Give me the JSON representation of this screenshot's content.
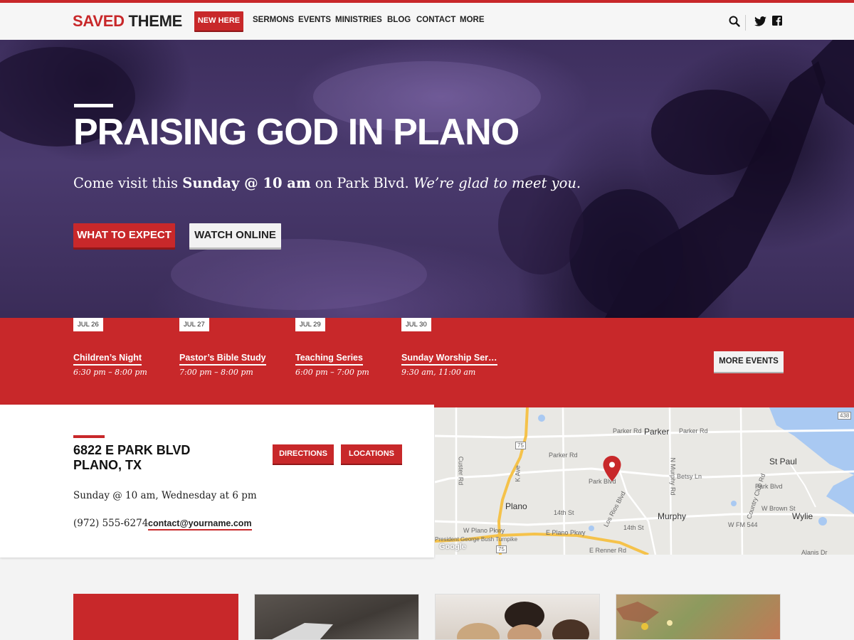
{
  "header": {
    "logo_part1": "SAVED",
    "logo_part2": "THEME",
    "new_here": "NEW HERE",
    "nav": [
      "SERMONS",
      "EVENTS",
      "MINISTRIES",
      "BLOG",
      "CONTACT",
      "MORE"
    ],
    "icons": [
      "search-icon",
      "twitter-icon",
      "facebook-icon"
    ]
  },
  "hero": {
    "title": "PRAISING GOD IN PLANO",
    "intro_a": "Come visit this ",
    "intro_bold": "Sunday @ 10 am",
    "intro_b": " on Park Blvd. ",
    "intro_italic": "We’re glad to meet you.",
    "btn_expect": "WHAT TO EXPECT",
    "btn_watch": "WATCH ONLINE"
  },
  "events": {
    "items": [
      {
        "date": "JUL 26",
        "title": "Children’s Night",
        "time": "6:30 pm – 8:00 pm"
      },
      {
        "date": "JUL 27",
        "title": "Pastor’s Bible Study",
        "time": "7:00 pm – 8:00 pm"
      },
      {
        "date": "JUL 29",
        "title": "Teaching Series",
        "time": "6:00 pm – 7:00 pm"
      },
      {
        "date": "JUL 30",
        "title": "Sunday Worship Ser…",
        "time": "9:30 am, 11:00 am"
      }
    ],
    "more_label": "MORE EVENTS"
  },
  "location": {
    "address_line1": "6822 E PARK BLVD",
    "address_line2": "PLANO, TX",
    "directions": "DIRECTIONS",
    "locations": "LOCATIONS",
    "times": "Sunday @ 10 am, Wednesday at 6 pm",
    "phone": "(972) 555-6274",
    "email": "contact@yourname.com"
  },
  "map": {
    "cities": [
      "Parker",
      "St Paul",
      "Plano",
      "Murphy",
      "Wylie"
    ],
    "roads": [
      "Parker Rd",
      "Parker Rd",
      "Parker Rd",
      "Park Blvd",
      "Park Blvd",
      "14th St",
      "14th St",
      "E Plano Pkwy",
      "W Plano Pkwy",
      "W FM 544",
      "W Brown St",
      "Betsy Ln",
      "Los Rios Blvd",
      "K Ave",
      "Custer Rd",
      "N Murphy Rd",
      "Country Club Rd",
      "E Renner Rd",
      "Alanis Dr",
      "President George Bush Turnpike"
    ],
    "shields": [
      "75",
      "75",
      "438"
    ],
    "attribution": "Google"
  }
}
